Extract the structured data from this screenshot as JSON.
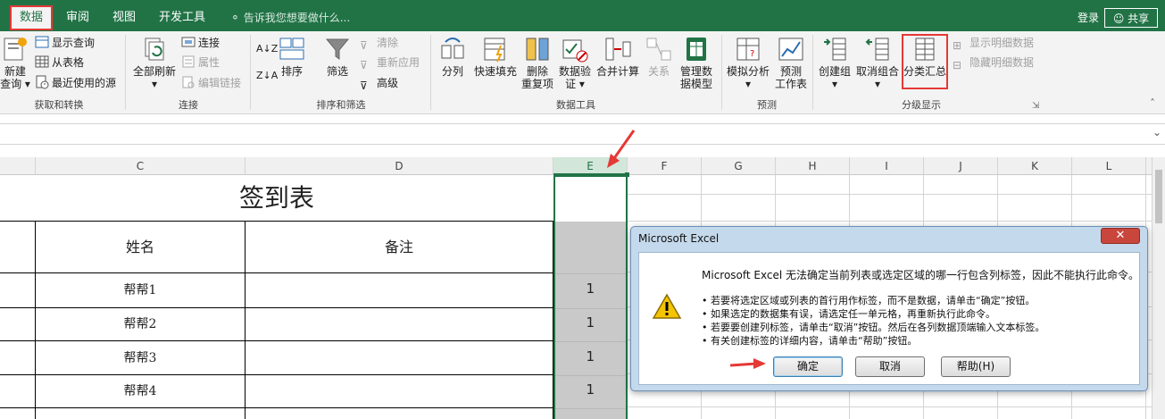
{
  "tabs": {
    "data": "数据",
    "review": "审阅",
    "view": "视图",
    "developer": "开发工具",
    "tellme": "告诉我您想要做什么...",
    "login": "登录",
    "share": "共享"
  },
  "ribbon": {
    "get_transform": {
      "new_query_1": "新建",
      "new_query_2": "查询",
      "show_queries": "显示查询",
      "from_table": "从表格",
      "recent_sources": "最近使用的源",
      "label": "获取和转换"
    },
    "connections": {
      "refresh_all": "全部刷新",
      "connections": "连接",
      "properties": "属性",
      "edit_links": "编辑链接",
      "label": "连接"
    },
    "sort_filter": {
      "sort": "排序",
      "filter": "筛选",
      "clear": "清除",
      "reapply": "重新应用",
      "advanced": "高级",
      "label": "排序和筛选"
    },
    "data_tools": {
      "text_to_columns": "分列",
      "flash_fill": "快速填充",
      "remove_dup_1": "删除",
      "remove_dup_2": "重复项",
      "validation_1": "数据验",
      "validation_2": "证",
      "consolidate": "合并计算",
      "relationships": "关系",
      "data_model_1": "管理数",
      "data_model_2": "据模型",
      "label": "数据工具"
    },
    "forecast": {
      "what_if": "模拟分析",
      "forecast_1": "预测",
      "forecast_2": "工作表",
      "label": "预测"
    },
    "outline": {
      "group": "创建组",
      "ungroup": "取消组合",
      "subtotal": "分类汇总",
      "show_detail": "显示明细数据",
      "hide_detail": "隐藏明细数据",
      "label": "分级显示"
    }
  },
  "sheet": {
    "columns": [
      "C",
      "D",
      "E",
      "F",
      "G",
      "H",
      "I",
      "J",
      "K",
      "L"
    ],
    "title": "签到表",
    "header_name": "姓名",
    "header_note": "备注",
    "rows": [
      {
        "name": "帮帮1",
        "e": "1"
      },
      {
        "name": "帮帮2",
        "e": "1"
      },
      {
        "name": "帮帮3",
        "e": "1"
      },
      {
        "name": "帮帮4",
        "e": "1"
      }
    ]
  },
  "dialog": {
    "title": "Microsoft Excel",
    "message": "Microsoft Excel 无法确定当前列表或选定区域的哪一行包含列标签，因此不能执行此命令。",
    "bullets": [
      "• 若要将选定区域或列表的首行用作标签，而不是数据，请单击“确定”按钮。",
      "• 如果选定的数据集有误，请选定任一单元格，再重新执行此命令。",
      "• 若要要创建列标签，请单击“取消”按钮。然后在各列数据顶端输入文本标签。",
      "• 有关创建标签的详细内容，请单击“帮助”按钮。"
    ],
    "ok": "确定",
    "cancel": "取消",
    "help": "帮助(H)"
  },
  "colors": {
    "excel_green": "#217346",
    "highlight_red": "#e53935",
    "selected_fill": "#c9c9c9"
  }
}
